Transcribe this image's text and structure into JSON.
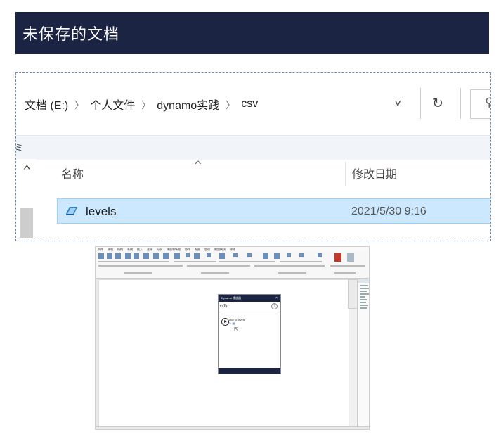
{
  "header": {
    "title": "未保存的文档"
  },
  "explorer": {
    "breadcrumb": [
      "文档 (E:)",
      "个人文件",
      "dynamo实践",
      "csv"
    ],
    "columns": {
      "name": "名称",
      "modified": "修改日期"
    },
    "files": [
      {
        "name": "levels",
        "modified": "2021/5/30 9:16"
      }
    ]
  },
  "revit": {
    "menu": [
      "文件",
      "建筑",
      "结构",
      "系统",
      "插入",
      "注释",
      "分析",
      "体量和场地",
      "协作",
      "视图",
      "管理",
      "附加模块",
      "修改"
    ],
    "dynamo_panel": {
      "title": "Dynamo 播放器",
      "file": "csv/To levels"
    }
  },
  "colors": {
    "header_bg": "#1c2444",
    "selection_bg": "#cce8ff"
  }
}
